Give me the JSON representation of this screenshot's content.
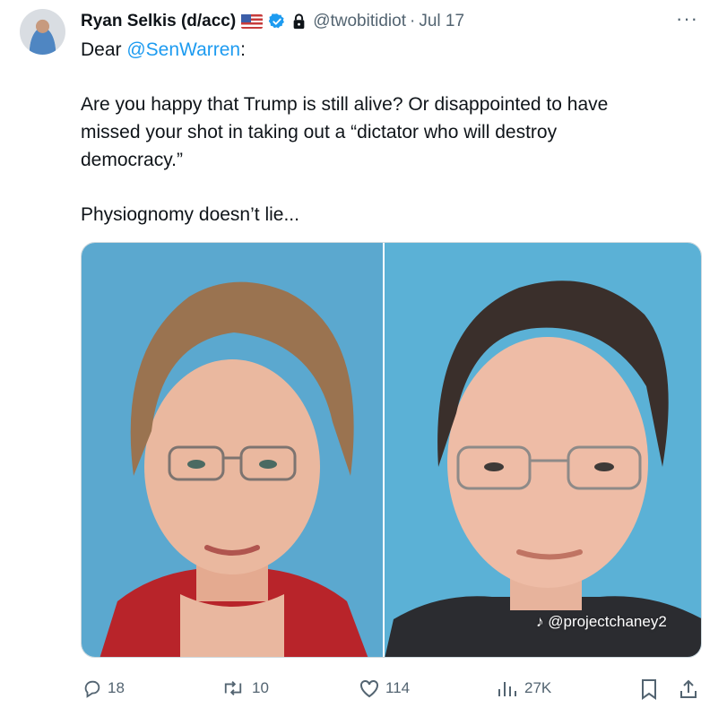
{
  "author": {
    "name": "Ryan Selkis (d/acc)",
    "handle": "@twobitidiot",
    "separator": "·",
    "date": "Jul 17"
  },
  "tweet": {
    "line1_prefix": "Dear ",
    "line1_mention": "@SenWarren",
    "line1_suffix": ":",
    "para2_line1": "Are you happy that Trump is still alive? Or disappointed to have",
    "para2_line2": "missed your shot in taking out a “dictator who will destroy",
    "para2_line3": "democracy.”",
    "para3": "Physiognomy doesn’t lie..."
  },
  "media": {
    "watermark": "@projectchaney2"
  },
  "actions": {
    "replies": "18",
    "reposts": "10",
    "likes": "114",
    "views": "27K"
  },
  "icons": [
    "flag-icon",
    "verified-badge-icon",
    "lock-icon",
    "more-options-icon",
    "reply-icon",
    "repost-icon",
    "like-icon",
    "views-icon",
    "bookmark-icon",
    "share-icon",
    "tiktok-icon"
  ],
  "colors": {
    "link": "#1d9bf0",
    "muted": "#536471",
    "text": "#0f1419"
  }
}
